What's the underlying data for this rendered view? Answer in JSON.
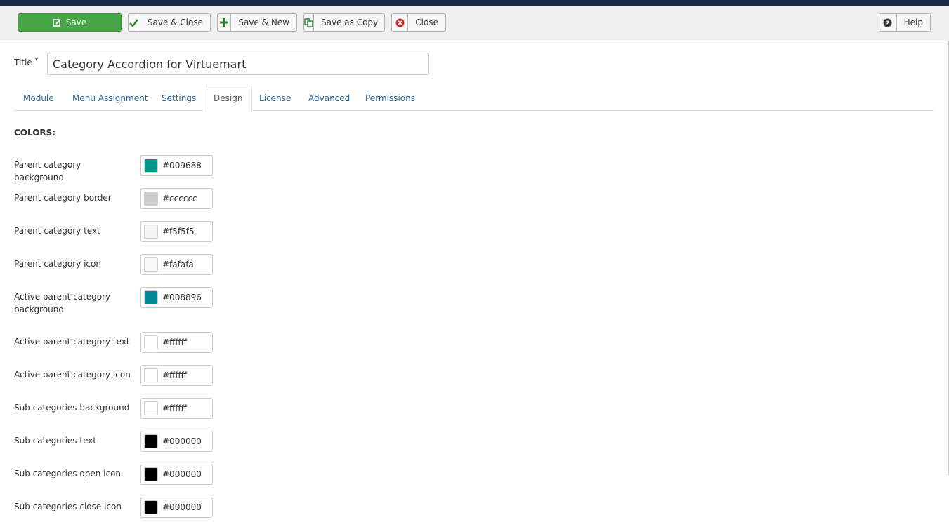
{
  "toolbar": {
    "save_label": "Save",
    "save_close_label": "Save & Close",
    "save_new_label": "Save & New",
    "save_copy_label": "Save as Copy",
    "close_label": "Close",
    "help_label": "Help"
  },
  "title_field": {
    "label": "Title",
    "required_mark": "*",
    "value": "Category Accordion for Virtuemart"
  },
  "tabs": [
    {
      "label": "Module"
    },
    {
      "label": "Menu Assignment"
    },
    {
      "label": "Settings"
    },
    {
      "label": "Design",
      "active": true
    },
    {
      "label": "License"
    },
    {
      "label": "Advanced"
    },
    {
      "label": "Permissions"
    }
  ],
  "section": {
    "heading": "COLORS:"
  },
  "fields": [
    {
      "label": "Parent category background",
      "value": "#009688"
    },
    {
      "label": "Parent category border",
      "value": "#cccccc"
    },
    {
      "label": "Parent category text",
      "value": "#f5f5f5"
    },
    {
      "label": "Parent category icon",
      "value": "#fafafa"
    },
    {
      "label": "Active parent category background",
      "value": "#008896"
    },
    {
      "label": "Active parent category text",
      "value": "#ffffff"
    },
    {
      "label": "Active parent category icon",
      "value": "#ffffff"
    },
    {
      "label": "Sub categories background",
      "value": "#ffffff"
    },
    {
      "label": "Sub categories text",
      "value": "#000000"
    },
    {
      "label": "Sub categories open icon",
      "value": "#000000"
    },
    {
      "label": "Sub categories close icon",
      "value": "#000000"
    }
  ]
}
